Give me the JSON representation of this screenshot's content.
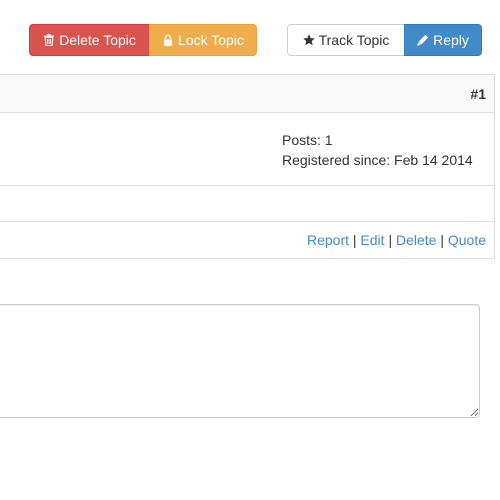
{
  "toolbar": {
    "delete_topic_label": "Delete Topic",
    "lock_topic_label": "Lock Topic",
    "track_topic_label": "Track Topic",
    "reply_label": "Reply"
  },
  "icons": {
    "delete": "trash-icon",
    "lock": "lock-icon",
    "track": "star-icon",
    "reply": "pencil-icon"
  },
  "post": {
    "number": "#1",
    "user_info": {
      "posts": "Posts: 1",
      "registered": "Registered since: Feb 14 2014"
    },
    "actions": {
      "report": "Report",
      "edit": "Edit",
      "delete": "Delete",
      "quote": "Quote",
      "separator": "|"
    }
  },
  "reply_box": {
    "value": ""
  },
  "colors": {
    "danger": "#d9534f",
    "warning": "#f0ad4e",
    "primary": "#428bca",
    "link": "#428bca",
    "border": "#dddddd"
  }
}
